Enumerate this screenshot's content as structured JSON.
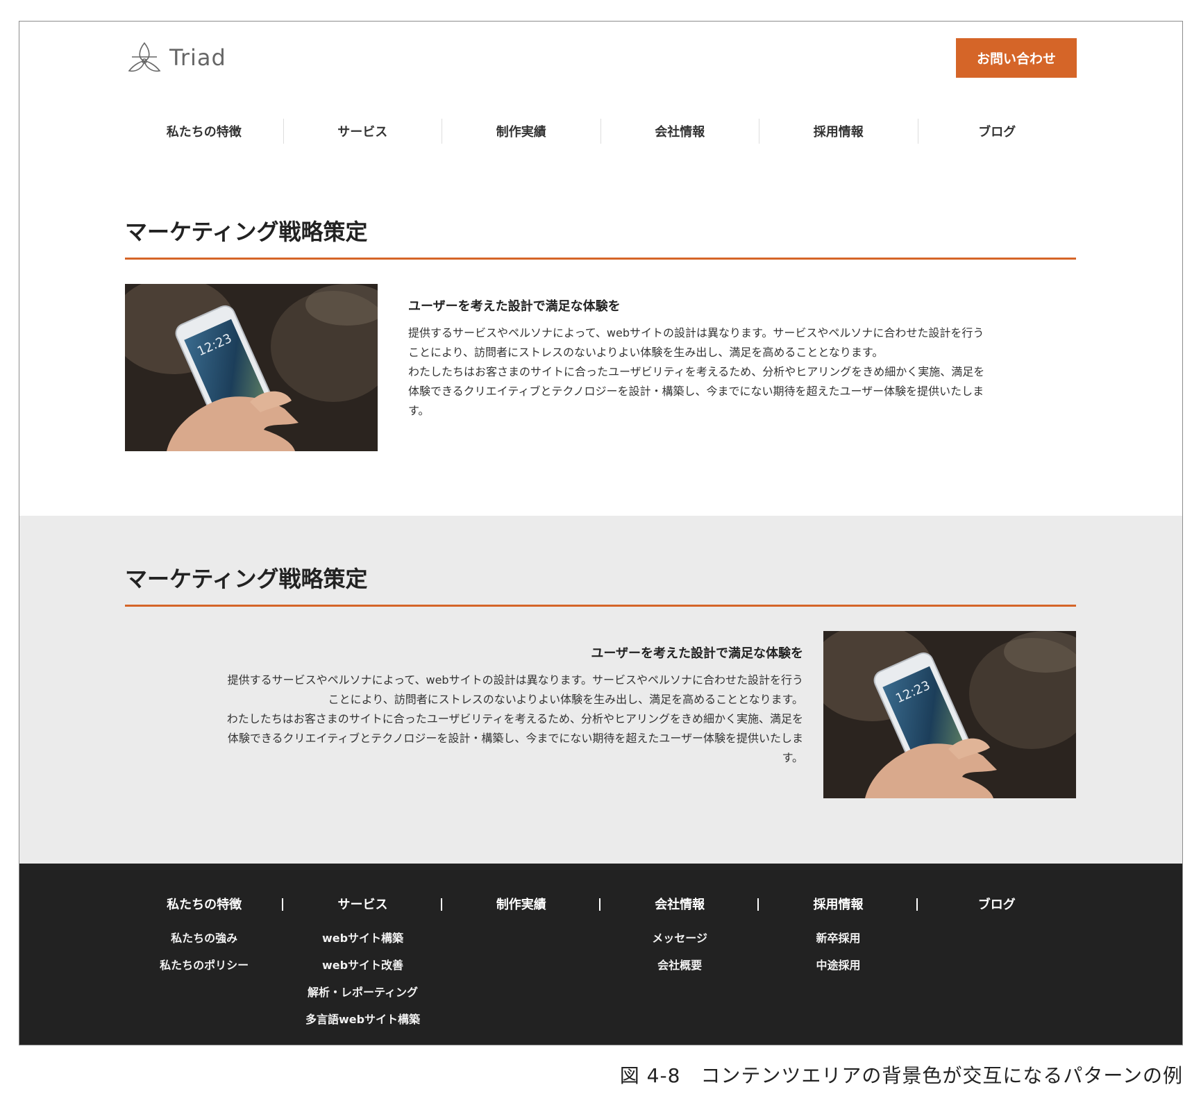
{
  "header": {
    "logo_text": "Triad",
    "contact_label": "お問い合わせ",
    "nav": [
      "私たちの特徴",
      "サービス",
      "制作実績",
      "会社情報",
      "採用情報",
      "ブログ"
    ]
  },
  "sections": [
    {
      "title": "マーケティング戦略策定",
      "heading": "ユーザーを考えた設計で満足な体験を",
      "lines": [
        "提供するサービスやペルソナによって、webサイトの設計は異なります。サービスやペルソナに合わせた設計を行う",
        "ことにより、訪問者にストレスのないよりよい体験を生み出し、満足を高めることとなります。",
        "わたしたちはお客さまのサイトに合ったユーザビリティを考えるため、分析やヒアリングをきめ細かく実施、満足を",
        "体験できるクリエイティブとテクノロジーを設計・構築し、今までにない期待を超えたユーザー体験を提供いたしま",
        "す。"
      ],
      "phone_time": "12:23"
    },
    {
      "title": "マーケティング戦略策定",
      "heading": "ユーザーを考えた設計で満足な体験を",
      "lines": [
        "提供するサービスやペルソナによって、webサイトの設計は異なります。サービスやペルソナに合わせた設計を行う",
        "ことにより、訪問者にストレスのないよりよい体験を生み出し、満足を高めることとなります。",
        "わたしたちはお客さまのサイトに合ったユーザビリティを考えるため、分析やヒアリングをきめ細かく実施、満足を",
        "体験できるクリエイティブとテクノロジーを設計・構築し、今までにない期待を超えたユーザー体験を提供いたしま",
        "す。"
      ],
      "phone_time": "12:23"
    }
  ],
  "footer": {
    "columns": [
      {
        "head": "私たちの特徴",
        "links": [
          "私たちの強み",
          "私たちのポリシー"
        ]
      },
      {
        "head": "サービス",
        "links": [
          "webサイト構築",
          "webサイト改善",
          "解析・レポーティング",
          "多言語webサイト構築"
        ]
      },
      {
        "head": "制作実績",
        "links": []
      },
      {
        "head": "会社情報",
        "links": [
          "メッセージ",
          "会社概要"
        ]
      },
      {
        "head": "採用情報",
        "links": [
          "新卒採用",
          "中途採用"
        ]
      },
      {
        "head": "ブログ",
        "links": []
      }
    ]
  },
  "caption": "図 4-8　コンテンツエリアの背景色が交互になるパターンの例",
  "colors": {
    "accent": "#d56528",
    "alt_background": "#ebebeb",
    "footer_background": "#222222"
  },
  "icons": [
    "triad-logo-icon",
    "phone-photo"
  ]
}
